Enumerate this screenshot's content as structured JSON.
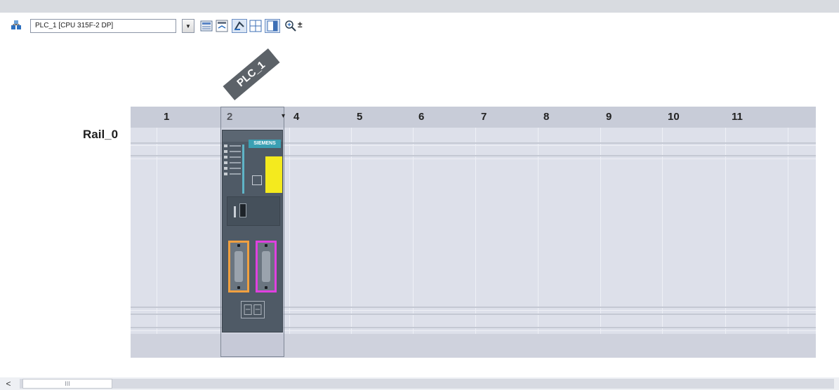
{
  "toolbar": {
    "device_select_value": "PLC_1 [CPU 315F-2 DP]",
    "icons": [
      "network-view-icon",
      "dropdown-arrow-icon",
      "device-properties-icon",
      "show-module-titles-icon",
      "overview-icon",
      "grid-icon",
      "device-view-icon",
      "zoom-icon",
      "zoom-step-icon"
    ],
    "dropdown_arrow_glyph": "▼",
    "zoom_step_glyph": "±"
  },
  "device_tag": "PLC_1",
  "rack": {
    "rail_label": "Rail_0",
    "slot_numbers": [
      "1",
      "2",
      "4",
      "5",
      "6",
      "7",
      "8",
      "9",
      "10",
      "11"
    ],
    "slot_dropdown_glyph": "▾",
    "selected_slot": "2"
  },
  "module": {
    "brand": "SIEMENS",
    "colors": {
      "port1": "#f0a040",
      "port2": "#e040e0",
      "card": "#f4ea1e"
    }
  },
  "scrollbar": {
    "left_arrow": "<",
    "thumb_grip": "III"
  }
}
